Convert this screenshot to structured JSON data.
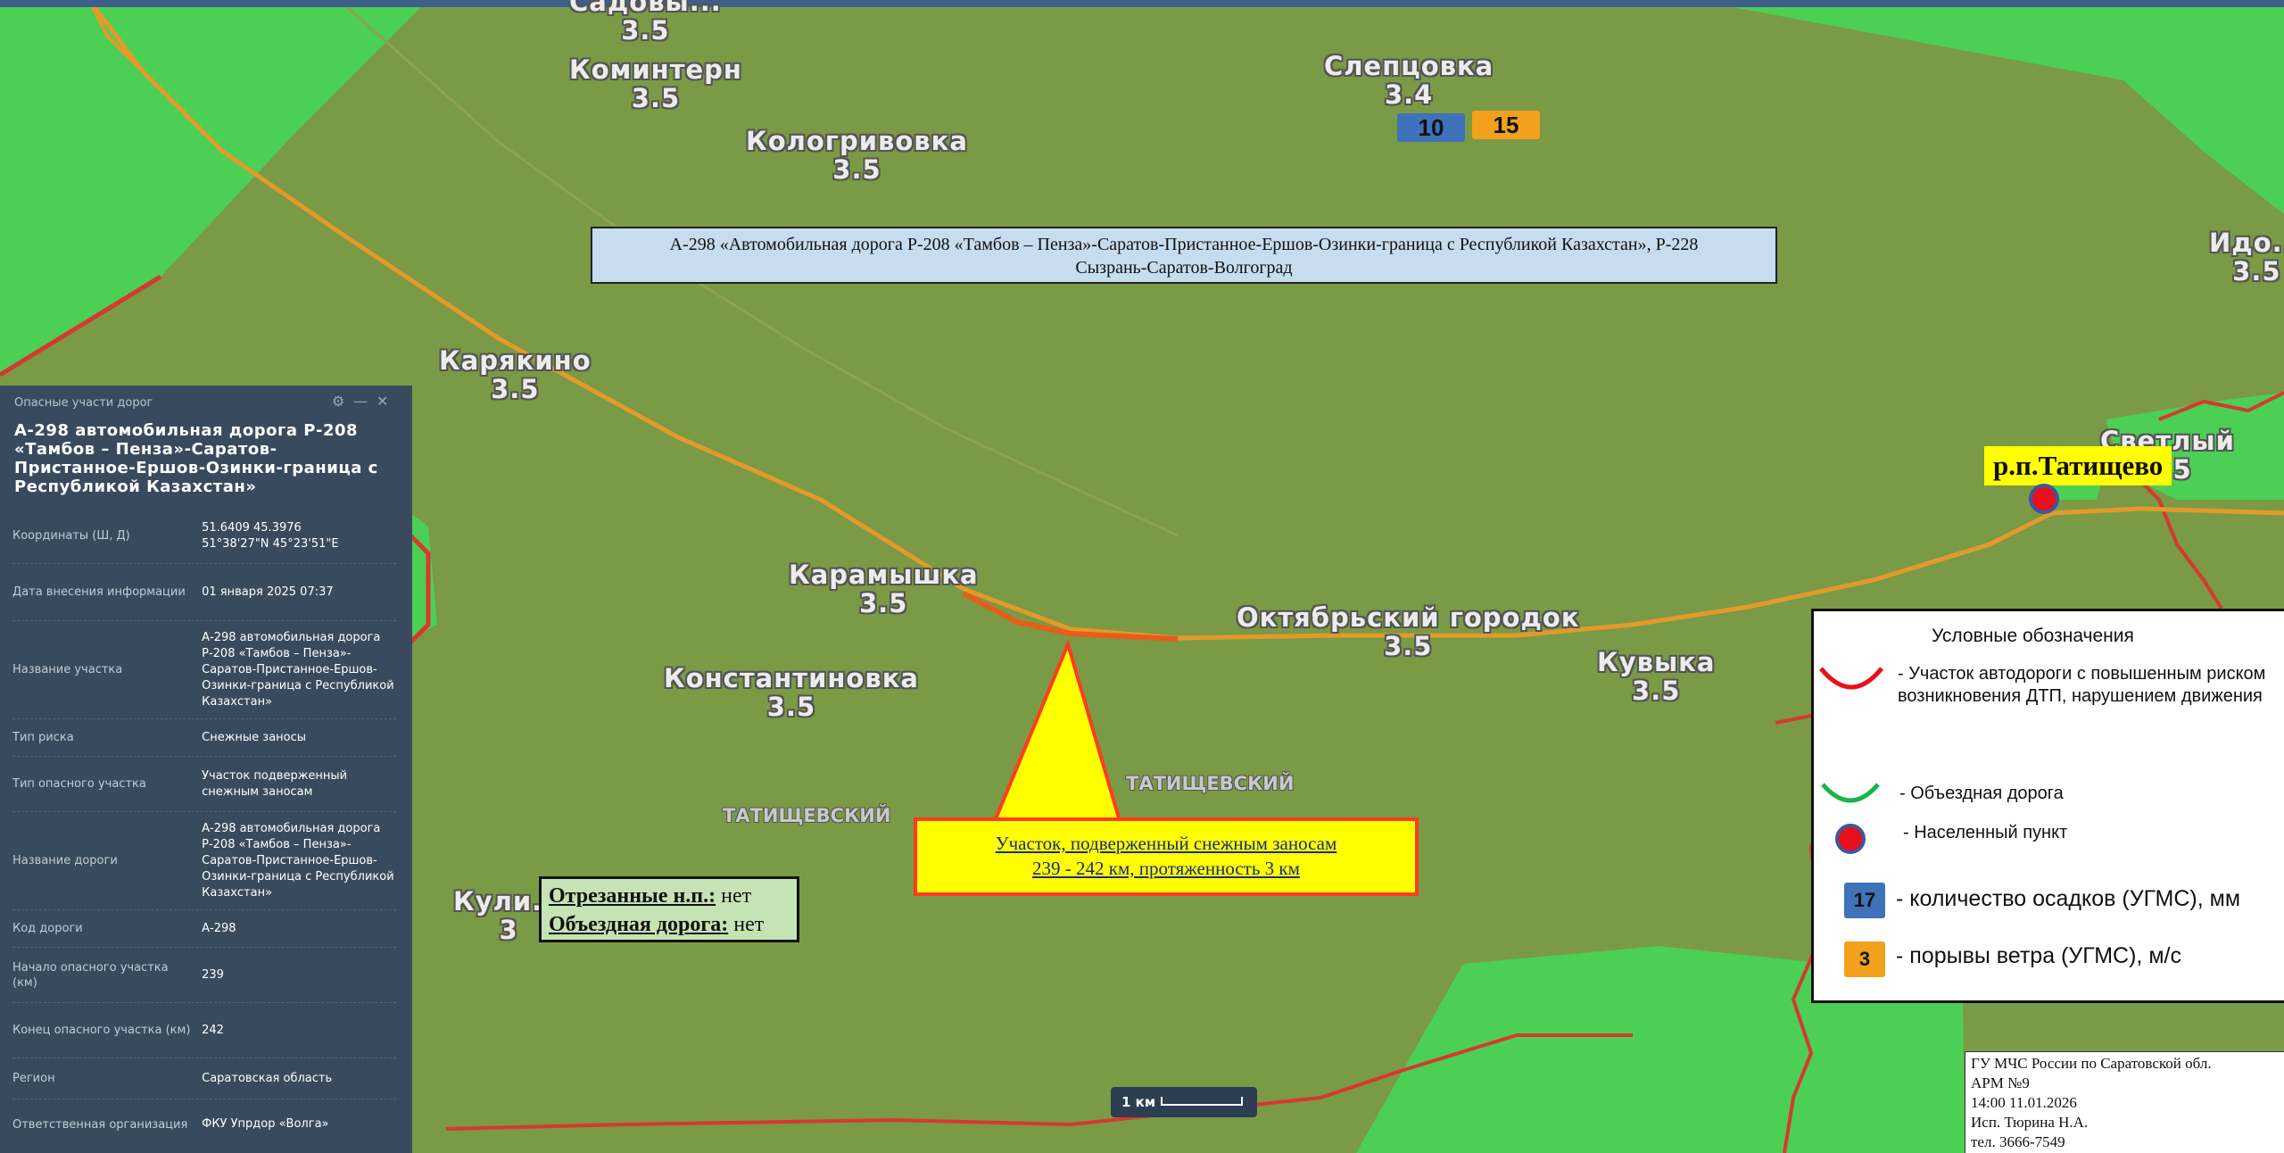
{
  "colors": {
    "map_bg": "#7a9a45",
    "forest": "#4ccf55",
    "road": "#e39a2a",
    "risk_segment": "#e85c1a",
    "boundary": "#d7382f",
    "title_box": "#c7dcef",
    "callout": "#ffff00",
    "precip_badge": "#3f72b9",
    "wind_badge": "#f3a11c",
    "sidebar_bg": "#3a4a5e"
  },
  "places": [
    {
      "name": "Садовы...",
      "value": "3.5"
    },
    {
      "name": "Коминтерн",
      "value": "3.5"
    },
    {
      "name": "Слепцовка",
      "value": "3.4"
    },
    {
      "name": "Кологривовка",
      "value": "3.5"
    },
    {
      "name": "Идо...",
      "value": "3.5"
    },
    {
      "name": "Карякино",
      "value": "3.5"
    },
    {
      "name": "Светлый",
      "value": "3.5"
    },
    {
      "name": "Карамышка",
      "value": "3.5"
    },
    {
      "name": "Октябрьский городок",
      "value": "3.5"
    },
    {
      "name": "Константиновка",
      "value": "3.5"
    },
    {
      "name": "Кувыка",
      "value": "3.5"
    },
    {
      "name": "Кули...",
      "value": "3"
    }
  ],
  "districts": [
    "ТАТИЩЕВСКИЙ",
    "ТАТИЩЕВСКИЙ"
  ],
  "weather_badges": {
    "precip": "10",
    "wind": "15"
  },
  "road_title": {
    "line1": "А-298 «Автомобильная дорога Р-208 «Тамбов – Пенза»-Саратов-Пристанное-Ершов-Озинки-граница с Республикой Казахстан», Р-228",
    "line2": "Сызрань-Саратов-Волгоград"
  },
  "callout": {
    "line1": "Участок, подверженный снежным заносам",
    "line2": "239 - 242 км,  протяженность 3 км"
  },
  "cutoff": {
    "cut_label": "Отрезанные н.п.:",
    "cut_value": " нет",
    "detour_label": "Объездная дорога:",
    "detour_value": " нет"
  },
  "settlement_label": "р.п.Татищево",
  "legend": {
    "title": "Условные обозначения",
    "risk": "- Участок автодороги с повышенным риском возникновения ДТП, нарушением движения",
    "detour": "- Объездная дорога",
    "settlement": "- Населенный пункт",
    "precip_sample": "17",
    "precip": "- количество осадков (УГМС), мм",
    "wind_sample": "3",
    "wind": "- порывы ветра (УГМС), м/с"
  },
  "sidebar": {
    "header": "Опасные участи дорог",
    "title": "А-298 автомобильная дорога Р-208 «Тамбов – Пенза»-Саратов-Пристанное-Ершов-Озинки-граница с Республикой Казахстан»",
    "rows": [
      {
        "key": "Координаты (Ш, Д)",
        "value": "51.6409 45.3976\n51°38'27\"N 45°23'51\"E"
      },
      {
        "key": "Дата внесения информации",
        "value": "01 января 2025 07:37"
      },
      {
        "key": "Название участка",
        "value": "А-298 автомобильная дорога Р-208 «Тамбов – Пенза»-Саратов-Пристанное-Ершов-Озинки-граница с Республикой Казахстан»"
      },
      {
        "key": "Тип риска",
        "value": "Снежные заносы"
      },
      {
        "key": "Тип опасного участка",
        "value": "Участок подверженный снежным заносам"
      },
      {
        "key": "Название дороги",
        "value": "А-298 автомобильная дорога Р-208 «Тамбов – Пенза»-Саратов-Пристанное-Ершов-Озинки-граница с Республикой Казахстан»"
      },
      {
        "key": "Код дороги",
        "value": "А-298"
      },
      {
        "key": "Начало опасного участка (км)",
        "value": "239"
      },
      {
        "key": "Конец опасного участка (км)",
        "value": "242"
      },
      {
        "key": "Регион",
        "value": "Саратовская область"
      },
      {
        "key": "Ответственная организация",
        "value": "ФКУ Упрдор «Волга»"
      }
    ]
  },
  "scale": "1 км",
  "footer": {
    "line1": "ГУ МЧС России по Саратовской обл.",
    "line2": "АРМ №9",
    "line3": "14:00  11.01.2026",
    "line4": "Исп. Тюрина Н.А.",
    "line5": "тел. 3666-7549"
  }
}
